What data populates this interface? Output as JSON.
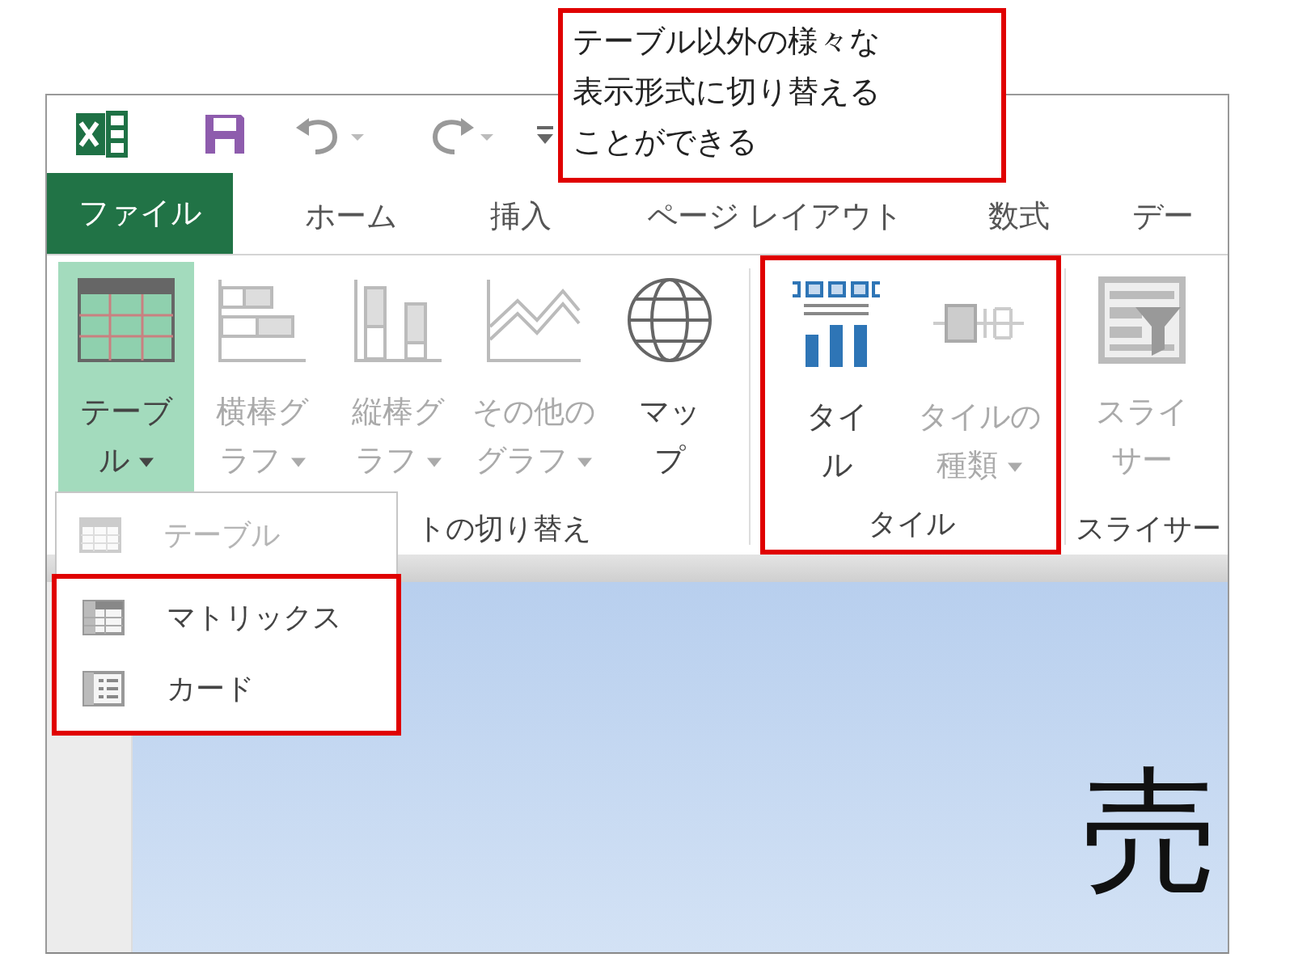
{
  "callout": {
    "lines": [
      "テーブル以外の様々な",
      "表示形式に切り替える",
      "ことができる"
    ]
  },
  "tabs": [
    {
      "label": "ファイル",
      "kind": "file"
    },
    {
      "label": "ホーム",
      "kind": "tab"
    },
    {
      "label": "挿入",
      "kind": "tab"
    },
    {
      "label": "ページ レイアウト",
      "kind": "tab"
    },
    {
      "label": "数式",
      "kind": "tab"
    },
    {
      "label": "デー",
      "kind": "tab"
    }
  ],
  "ribbon_groups": [
    {
      "label": "トの切り替え",
      "annotated": false,
      "buttons": [
        {
          "kind": "table",
          "lines": [
            "テーブ",
            "ル"
          ],
          "dropdown": true,
          "disabled": false,
          "pressed": true
        },
        {
          "kind": "bar",
          "lines": [
            "横棒グ",
            "ラフ"
          ],
          "dropdown": true,
          "disabled": true,
          "pressed": false
        },
        {
          "kind": "column",
          "lines": [
            "縦棒グ",
            "ラフ"
          ],
          "dropdown": true,
          "disabled": true,
          "pressed": false
        },
        {
          "kind": "line",
          "lines": [
            "その他の",
            "グラフ"
          ],
          "dropdown": true,
          "disabled": true,
          "pressed": false
        },
        {
          "kind": "map",
          "lines": [
            "マッ",
            "プ"
          ],
          "dropdown": false,
          "disabled": false,
          "pressed": false
        }
      ]
    },
    {
      "label": "タイル",
      "annotated": true,
      "buttons": [
        {
          "kind": "tiles",
          "lines": [
            "タイ",
            "ル"
          ],
          "dropdown": false,
          "disabled": false,
          "pressed": false
        },
        {
          "kind": "tiletype",
          "lines": [
            "タイルの",
            "種類"
          ],
          "dropdown": true,
          "disabled": true,
          "pressed": false
        }
      ]
    },
    {
      "label": "スライサー",
      "annotated": false,
      "buttons": [
        {
          "kind": "slicer",
          "lines": [
            "スライ",
            "サー"
          ],
          "dropdown": false,
          "disabled": true,
          "pressed": false
        }
      ]
    }
  ],
  "menu": {
    "items": [
      {
        "kind": "table",
        "label": "テーブル",
        "disabled": true,
        "annotated": false
      },
      {
        "kind": "matrix",
        "label": "マトリックス",
        "disabled": false,
        "annotated": true
      },
      {
        "kind": "card",
        "label": "カード",
        "disabled": false,
        "annotated": true
      }
    ]
  },
  "canvas": {
    "title": "売"
  }
}
